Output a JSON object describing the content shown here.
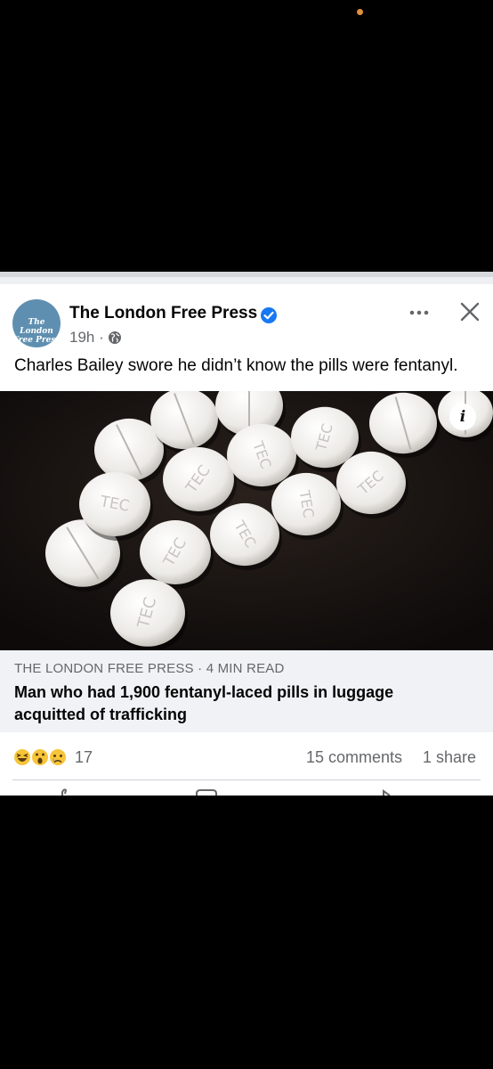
{
  "post": {
    "page_name": "The London Free Press",
    "avatar_text": "The London Free Press",
    "time": "19h",
    "separator": "·",
    "caption": "Charles Bailey swore he didn’t know the pills were fentanyl.",
    "icons": [
      "verified-badge-icon",
      "globe-icon",
      "more-options-icon",
      "close-icon",
      "info-icon"
    ],
    "colors": {
      "verified": "#1877f2",
      "link_box": "#f0f2f5",
      "meta_text": "#65676b"
    }
  },
  "photo": {
    "pill_imprint": "TEC",
    "info_label": "i"
  },
  "link_preview": {
    "source": "THE LONDON FREE PRESS",
    "separator": "·",
    "read_time": "4 MIN READ",
    "headline": "Man who had 1,900 fentanyl-laced pills in luggage acquitted of trafficking"
  },
  "engagement": {
    "reaction_count": "17",
    "comments": "15 comments",
    "shares": "1 share",
    "reaction_icons": [
      "haha-icon",
      "wow-icon",
      "sad-icon"
    ]
  }
}
